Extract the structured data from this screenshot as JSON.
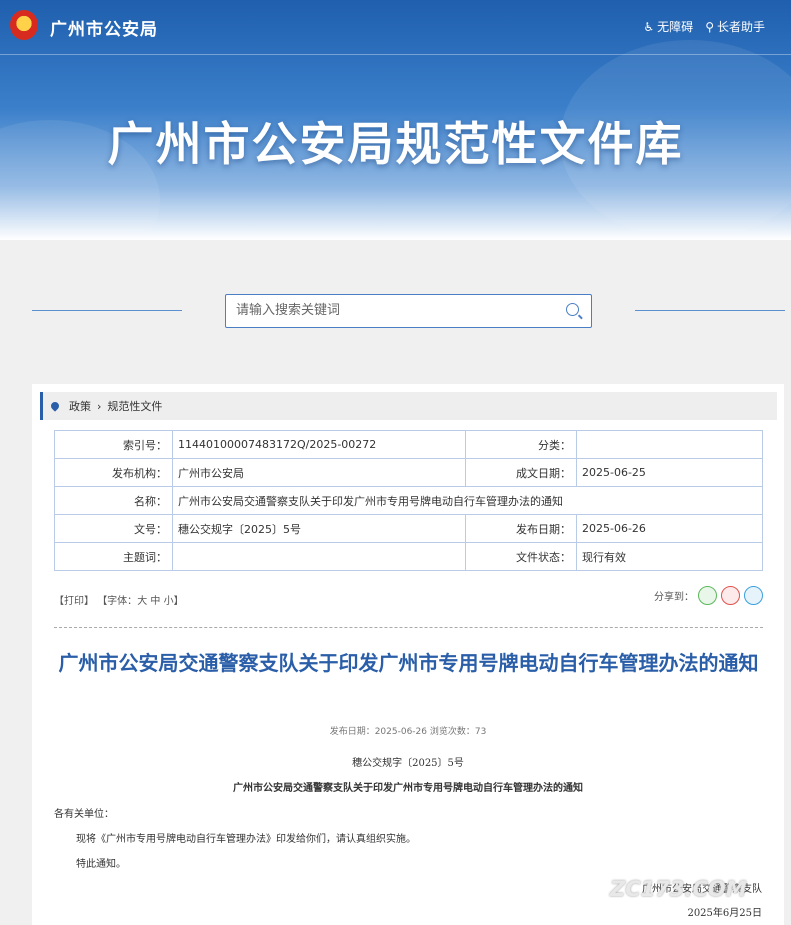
{
  "header": {
    "org_name": "广州市公安局",
    "tools": [
      {
        "icon": "accessibility-icon",
        "label": "无障碍"
      },
      {
        "icon": "elderly-helper-icon",
        "label": "长者助手"
      }
    ],
    "banner_title": "广州市公安局规范性文件库"
  },
  "search": {
    "placeholder": "请输入搜索关键词"
  },
  "breadcrumb": {
    "items": [
      "政策",
      "规范性文件"
    ]
  },
  "meta": {
    "index_label": "索引号：",
    "index_value": "11440100007483172Q/2025-00272",
    "category_label": "分类：",
    "category_value": "",
    "issuer_label": "发布机构：",
    "issuer_value": "广州市公安局",
    "created_label": "成文日期：",
    "created_value": "2025-06-25",
    "name_label": "名称：",
    "name_value": "广州市公安局交通警察支队关于印发广州市专用号牌电动自行车管理办法的通知",
    "docno_label": "文号：",
    "docno_value": "穗公交规字〔2025〕5号",
    "pubdate_label": "发布日期：",
    "pubdate_value": "2025-06-26",
    "keywords_label": "主题词：",
    "keywords_value": "",
    "status_label": "文件状态：",
    "status_value": "现行有效"
  },
  "toolbar": {
    "print": "【打印】",
    "font_prefix": "【字体：",
    "font_large": "大",
    "font_medium": "中",
    "font_small": "小",
    "font_suffix": "】",
    "share_label": "分享到："
  },
  "article": {
    "title": "广州市公安局交通警察支队关于印发广州市专用号牌电动自行车管理办法的通知",
    "pubinfo": "发布日期：2025-06-26  浏览次数：73",
    "docno": "穗公交规字〔2025〕5号",
    "subhead": "广州市公安局交通警察支队关于印发广州市专用号牌电动自行车管理办法的通知",
    "greeting": "各有关单位：",
    "body": "现将《广州市专用号牌电动自行车管理办法》印发给你们，请认真组织实施。",
    "closing": "特此通知。",
    "signer": "广州市公安局交通警察支队",
    "sign_date": "2025年6月25日"
  },
  "watermark": "ZC173.COM"
}
